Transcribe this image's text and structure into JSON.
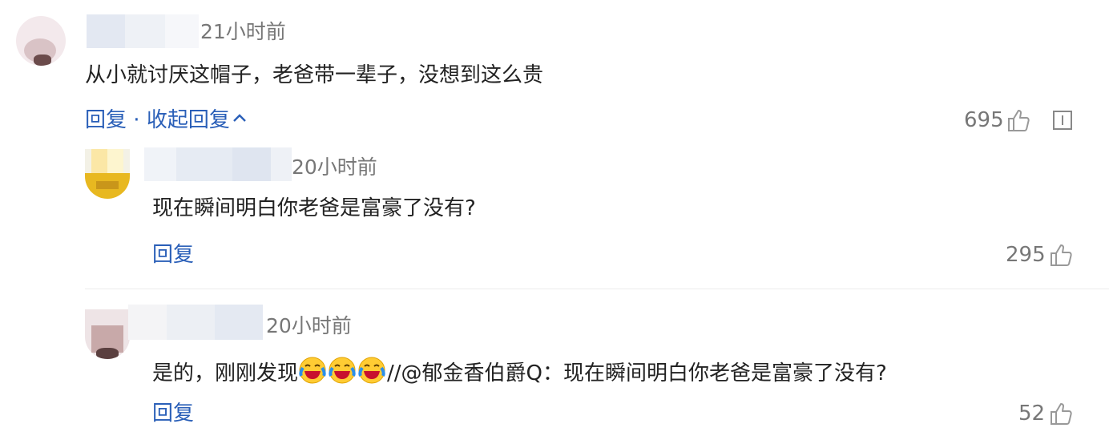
{
  "comments": [
    {
      "time": "21小时前",
      "text": "从小就讨厌这帽子，老爸带一辈子，没想到这么贵",
      "reply_label": "回复",
      "separator": " · ",
      "collapse_label": "收起回复",
      "likes": "695",
      "replies": [
        {
          "time": "20小时前",
          "text": "现在瞬间明白你老爸是富豪了没有?",
          "reply_label": "回复",
          "likes": "295"
        }
      ]
    },
    {
      "time": "20小时前",
      "text_before": "是的，刚刚发现",
      "text_after": "//@郁金香伯爵Q：现在瞬间明白你老爸是富豪了没有?",
      "emoji": [
        "crying-laughing-emoji",
        "crying-laughing-emoji",
        "crying-laughing-emoji"
      ],
      "reply_label": "回复",
      "likes": "52"
    }
  ],
  "colors": {
    "link": "#2a5fb8",
    "muted": "#777777",
    "text": "#222222"
  }
}
